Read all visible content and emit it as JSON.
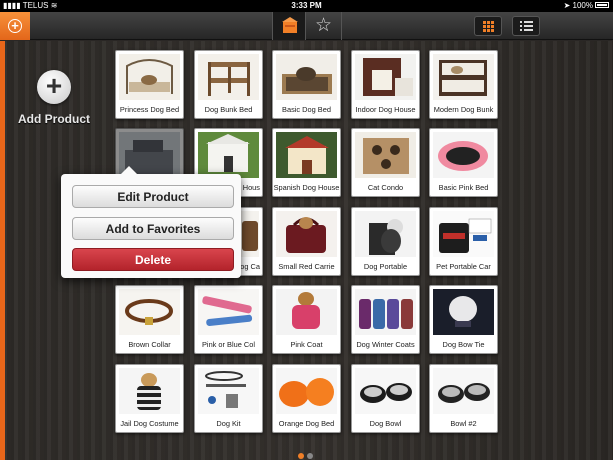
{
  "status_bar": {
    "carrier": "TELUS",
    "time": "3:33 PM",
    "battery": "100%"
  },
  "toolbar": {
    "add_icon": "plus-circle-icon",
    "store_tab_icon": "store-icon",
    "favorites_tab_icon": "star-icon",
    "grid_view_icon": "grid-icon",
    "list_view_icon": "list-icon",
    "accent_color": "#e8661a"
  },
  "sidebar": {
    "add_product_label": "Add Product"
  },
  "products": [
    {
      "name": "Princess Dog Bed"
    },
    {
      "name": "Dog Bunk Bed"
    },
    {
      "name": "Basic Dog Bed"
    },
    {
      "name": "Indoor Dog House"
    },
    {
      "name": "Modern Dog Bunk"
    },
    {
      "name": ""
    },
    {
      "name": "Hous"
    },
    {
      "name": "Spanish Dog House"
    },
    {
      "name": "Cat Condo"
    },
    {
      "name": "Basic Pink Bed"
    },
    {
      "name": ""
    },
    {
      "name": "og Ca"
    },
    {
      "name": "Small Red Carrie"
    },
    {
      "name": "Dog Portable"
    },
    {
      "name": "Pet Portable Car"
    },
    {
      "name": "Brown Collar"
    },
    {
      "name": "Pink or Blue Col"
    },
    {
      "name": "Pink Coat"
    },
    {
      "name": "Dog Winter Coats"
    },
    {
      "name": "Dog Bow Tie"
    },
    {
      "name": "Jail Dog Costume"
    },
    {
      "name": "Dog Kit"
    },
    {
      "name": "Orange Dog Bed"
    },
    {
      "name": "Dog Bowl"
    },
    {
      "name": "Bowl #2"
    }
  ],
  "popover": {
    "edit_label": "Edit Product",
    "favorites_label": "Add to Favorites",
    "delete_label": "Delete"
  },
  "pagination": {
    "page_count": 2,
    "current_page": 1
  }
}
